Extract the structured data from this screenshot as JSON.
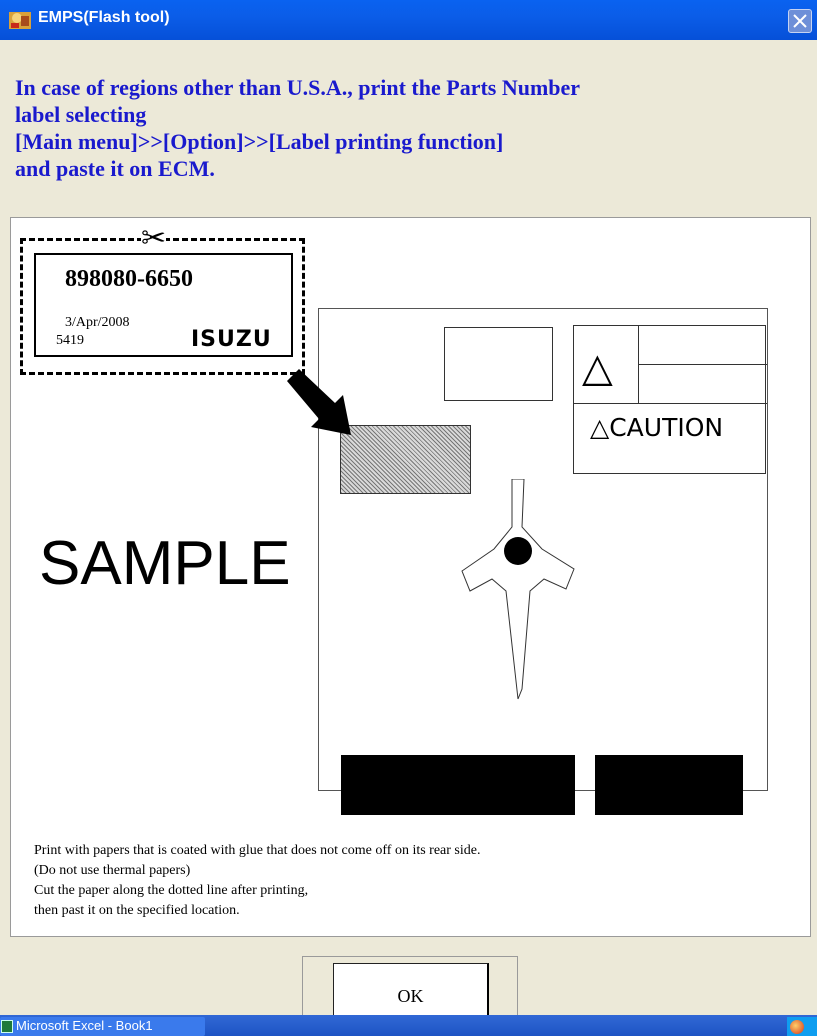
{
  "window": {
    "title": "EMPS(Flash tool)",
    "icon": "emps-app-icon"
  },
  "message": {
    "lines": [
      "In case of regions other than U.S.A., print the Parts Number",
      "label selecting",
      "[Main menu]>>[Option]>>[Label printing function]",
      "and paste it on ECM."
    ],
    "color": "#1a1acd"
  },
  "sample_label": {
    "part_number": "898080-6650",
    "date": "3/Apr/2008",
    "serial": "5419",
    "brand": "ISUZU"
  },
  "diagram": {
    "sample_text": "SAMPLE",
    "caution_text": "△CAUTION",
    "warning_symbol": "△"
  },
  "instructions": [
    "Print with papers that is coated with glue that does not come off on its rear side.",
    "(Do not use thermal papers)",
    "Cut the paper along the dotted line after printing,",
    "then past it on the specified location."
  ],
  "buttons": {
    "ok": "OK"
  },
  "taskbar": {
    "item": "Microsoft Excel - Book1"
  }
}
